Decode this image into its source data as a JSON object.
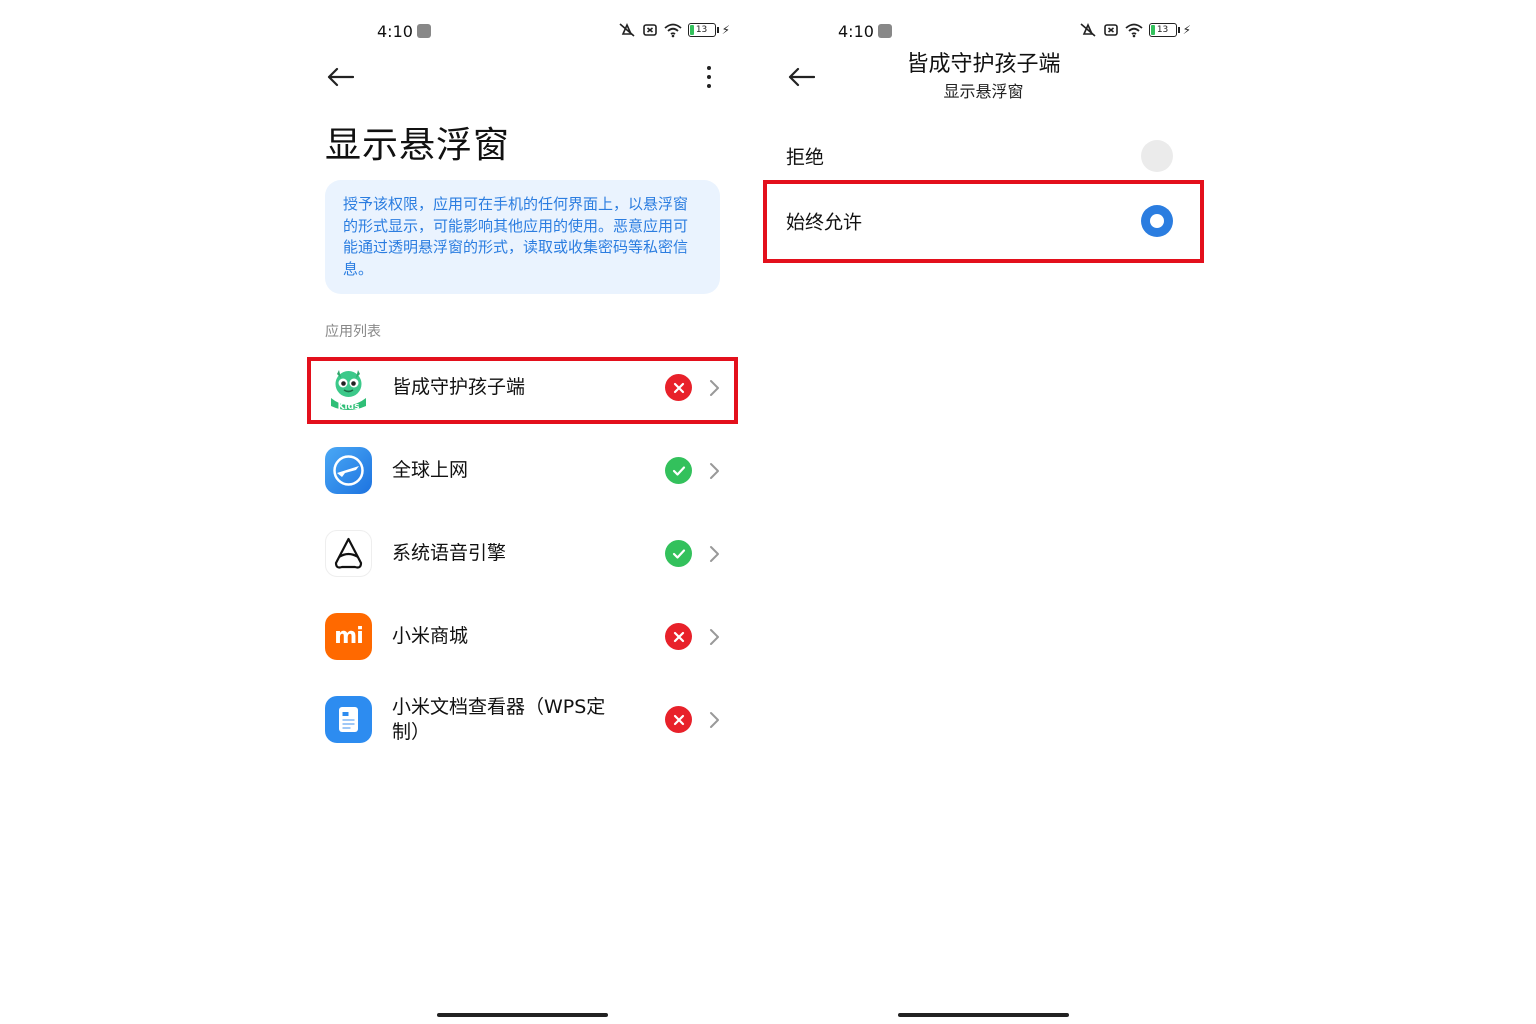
{
  "left_screen": {
    "status_bar": {
      "time": "4:10",
      "battery": "13"
    },
    "page_title": "显示悬浮窗",
    "info_text": "授予该权限，应用可在手机的任何界面上，以悬浮窗的形式显示，可能影响其他应用的使用。恶意应用可能通过透明悬浮窗的形式，读取或收集密码等私密信息。",
    "section_label": "应用列表",
    "apps": [
      {
        "name": "皆成守护孩子端",
        "status": "deny",
        "icon": "kids-guard-icon",
        "icon_text": "Kids"
      },
      {
        "name": "全球上网",
        "status": "allow",
        "icon": "global-internet-icon"
      },
      {
        "name": "系统语音引擎",
        "status": "allow",
        "icon": "voice-engine-icon"
      },
      {
        "name": "小米商城",
        "status": "deny",
        "icon": "mi-store-icon",
        "icon_text": "mi"
      },
      {
        "name": "小米文档查看器（WPS定制）",
        "status": "deny",
        "icon": "document-viewer-icon"
      }
    ]
  },
  "right_screen": {
    "status_bar": {
      "time": "4:10",
      "battery": "13"
    },
    "nav_title": "皆成守护孩子端",
    "nav_subtitle": "显示悬浮窗",
    "options": [
      {
        "label": "拒绝",
        "selected": false
      },
      {
        "label": "始终允许",
        "selected": true
      }
    ]
  },
  "colors": {
    "accent_blue": "#2b7de0",
    "deny_red": "#e8212a",
    "allow_green": "#33c15c",
    "highlight_red": "#e3101c",
    "info_card_bg": "#eaf3fe"
  }
}
